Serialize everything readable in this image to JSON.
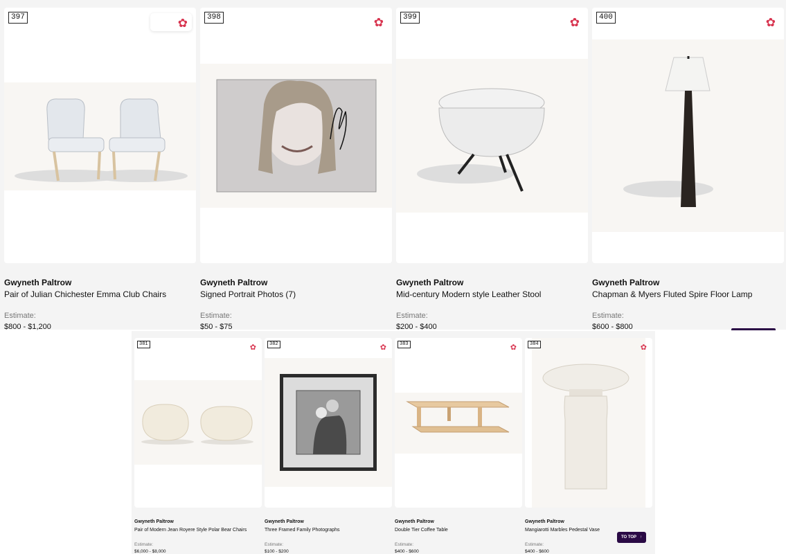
{
  "colors": {
    "accent": "#2a0a45",
    "favorite": "#d8344f",
    "panel_bg": "#f4f4f4"
  },
  "top_row": [
    {
      "lot": "397",
      "artist": "Gwyneth Paltrow",
      "title": "Pair of Julian Chichester Emma Club Chairs",
      "estimate_label": "Estimate:",
      "estimate": "$800 - $1,200",
      "icon": "favorite-flower-icon"
    },
    {
      "lot": "398",
      "artist": "Gwyneth Paltrow",
      "title": "Signed Portrait Photos (7)",
      "estimate_label": "Estimate:",
      "estimate": "$50 - $75",
      "icon": "favorite-flower-icon"
    },
    {
      "lot": "399",
      "artist": "Gwyneth Paltrow",
      "title": "Mid-century Modern style Leather Stool",
      "estimate_label": "Estimate:",
      "estimate": "$200 - $400",
      "icon": "favorite-flower-icon"
    },
    {
      "lot": "400",
      "artist": "Gwyneth Paltrow",
      "title": "Chapman & Myers Fluted Spire Floor Lamp",
      "estimate_label": "Estimate:",
      "estimate": "$600 - $800",
      "icon": "favorite-flower-icon"
    }
  ],
  "bottom_row": [
    {
      "lot": "381",
      "artist": "Gwyneth Paltrow",
      "title": "Pair of Modern Jean Royere Style Polar Bear Chairs",
      "estimate_label": "Estimate:",
      "estimate": "$6,000 - $8,000",
      "icon": "favorite-flower-icon"
    },
    {
      "lot": "382",
      "artist": "Gwyneth Paltrow",
      "title": "Three Framed Family Photographs",
      "estimate_label": "Estimate:",
      "estimate": "$100 - $200",
      "icon": "favorite-flower-icon"
    },
    {
      "lot": "383",
      "artist": "Gwyneth Paltrow",
      "title": "Double Tier Coffee Table",
      "estimate_label": "Estimate:",
      "estimate": "$400 - $600",
      "icon": "favorite-flower-icon"
    },
    {
      "lot": "384",
      "artist": "Gwyneth Paltrow",
      "title": "Mangiarotti Marbles Pedestal Vase",
      "estimate_label": "Estimate:",
      "estimate": "$400 - $600",
      "icon": "favorite-flower-icon"
    }
  ],
  "to_top": {
    "label": "TO TOP",
    "icon": "arrow-up-icon"
  }
}
